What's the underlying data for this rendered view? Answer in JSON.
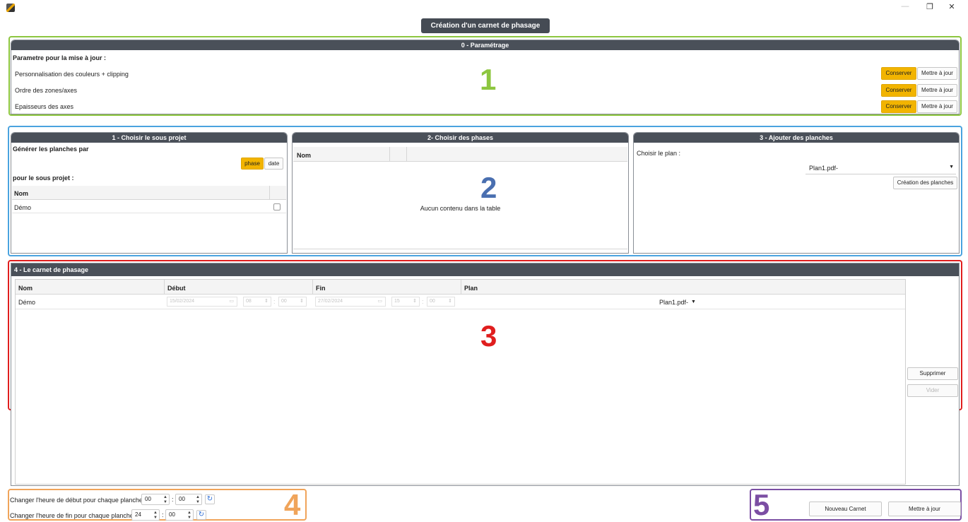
{
  "window": {
    "title": "Création d'un carnet de phasage",
    "minimize": "—",
    "restore": "❐",
    "close": "✕"
  },
  "colors": {
    "header": "#4a5059",
    "accent": "#f2b400",
    "outline_1": "#8dc63f",
    "outline_2": "#4aa3df",
    "outline_3": "#e01e1e",
    "outline_4": "#f0a45a",
    "outline_5": "#7b4ea3"
  },
  "markers": {
    "m1": "1",
    "m2": "2",
    "m3": "3",
    "m4": "4",
    "m5": "5"
  },
  "settings": {
    "header": "0 - Paramétrage",
    "subtitle": "Parametre pour la mise à jour :",
    "rows": [
      {
        "label": "Personnalisation des couleurs  + clipping",
        "keep": "Conserver",
        "update": "Mettre à jour"
      },
      {
        "label": "Ordre des zones/axes",
        "keep": "Conserver",
        "update": "Mettre à jour"
      },
      {
        "label": "Epaisseurs des axes",
        "keep": "Conserver",
        "update": "Mettre à jour"
      }
    ]
  },
  "subproject": {
    "header": "1 - Choisir le sous projet",
    "generate_label": "Générer les planches par",
    "toggle_phase": "phase",
    "toggle_date": "date",
    "for_label": "pour le sous projet :",
    "col_name": "Nom",
    "rows": [
      {
        "name": "Démo"
      }
    ]
  },
  "phases": {
    "header": "2- Choisir des phases",
    "col_name": "Nom",
    "empty": "Aucun contenu dans la table"
  },
  "boards": {
    "header": "3 - Ajouter des planches",
    "choose_plan": "Choisir le plan :",
    "plan_value": "Plan1.pdf-",
    "create_button": "Création des planches"
  },
  "carnet": {
    "header": "4 - Le carnet de phasage",
    "cols": {
      "name": "Nom",
      "start": "Début",
      "end": "Fin",
      "plan": "Plan"
    },
    "rows": [
      {
        "name": "Démo",
        "start_date": "15/02/2024",
        "start_h": "08",
        "start_m": "00",
        "end_date": "27/02/2024",
        "end_h": "15",
        "end_m": "00",
        "plan": "Plan1.pdf-"
      }
    ],
    "delete_button": "Supprimer",
    "clear_button": "Vider"
  },
  "time_controls": {
    "start_label": "Changer l'heure de début pour chaque planche :",
    "start_h": "00",
    "start_m": "00",
    "end_label": "Changer l'heure de fin pour chaque planche :",
    "end_h": "24",
    "end_m": "00",
    "sep": ":"
  },
  "footer": {
    "new_button": "Nouveau Carnet",
    "update_button": "Mettre à jour"
  }
}
